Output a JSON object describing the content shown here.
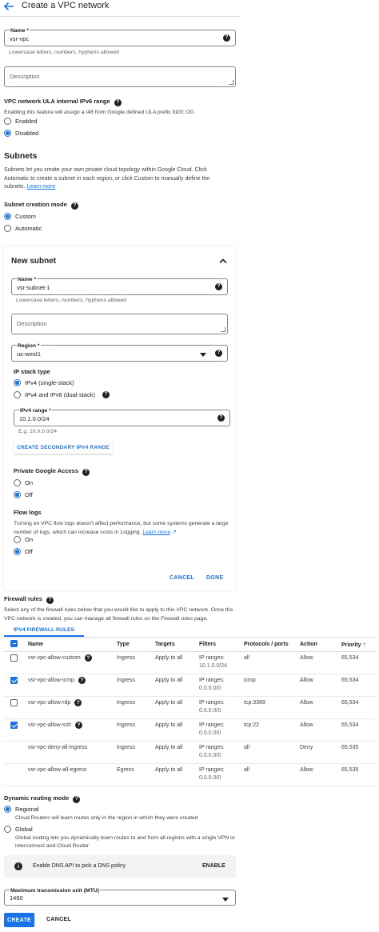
{
  "page_title": "Create a VPC network",
  "name_field": {
    "label": "Name *",
    "value": "vsr-vpc",
    "hint": "Lowercase letters, numbers, hyphens allowed"
  },
  "description_field": {
    "placeholder": "Description"
  },
  "ula": {
    "heading": "VPC network ULA internal IPv6 range",
    "text": "Enabling this feature will assign a /48 from Google defined ULA prefix fd20::/20.",
    "options": [
      "Enabled",
      "Disabled"
    ],
    "selected": "Disabled"
  },
  "subnets": {
    "heading": "Subnets",
    "text": "Subnets let you create your own private cloud topology within Google Cloud. Click Automatic to create a subnet in each region, or click Custom to manually define the subnets.",
    "learn_more": "Learn more",
    "mode_heading": "Subnet creation mode",
    "mode_options": [
      "Custom",
      "Automatic"
    ],
    "mode_selected": "Custom"
  },
  "new_subnet": {
    "title": "New subnet",
    "name_label": "Name *",
    "name_value": "vsr-subnet-1",
    "name_hint": "Lowercase letters, numbers, hyphens allowed",
    "description_placeholder": "Description",
    "region_label": "Region *",
    "region_value": "us-west1",
    "ip_stack_heading": "IP stack type",
    "ip_stack_options": [
      "IPv4 (single-stack)",
      "IPv4 and IPv6 (dual-stack)"
    ],
    "ip_stack_selected": "IPv4 (single-stack)",
    "ipv4_label": "IPv4 range *",
    "ipv4_value": "10.1.0.0/24",
    "ipv4_hint": "E.g. 10.0.0.0/24",
    "secondary_button": "CREATE SECONDARY IPV4 RANGE",
    "pga_heading": "Private Google Access",
    "pga_options": [
      "On",
      "Off"
    ],
    "pga_selected": "Off",
    "flow_heading": "Flow logs",
    "flow_text": "Turning on VPC flow logs doesn't affect performance, but some systems generate a large number of logs, which can increase costs in Logging.",
    "flow_learn_more": "Learn more",
    "flow_options": [
      "On",
      "Off"
    ],
    "flow_selected": "Off",
    "cancel": "CANCEL",
    "done": "DONE"
  },
  "firewall": {
    "heading": "Firewall rules",
    "text": "Select any of the firewall rules below that you would like to apply to this VPC network. Once the VPC network is created, you can manage all firewall rules on the Firewall rules page.",
    "tab": "IPV4 FIREWALL RULES",
    "columns": [
      "Name",
      "Type",
      "Targets",
      "Filters",
      "Protocols / ports",
      "Action",
      "Priority"
    ],
    "rows": [
      {
        "checkbox": "unchecked",
        "name": "vsr-vpc-allow-custom",
        "help": true,
        "type": "Ingress",
        "targets": "Apply to all",
        "filter1": "IP ranges:",
        "filter2": "10.1.0.0/24",
        "protocols": "all",
        "action": "Allow",
        "priority": "65,534"
      },
      {
        "checkbox": "checked",
        "name": "vsr-vpc-allow-icmp",
        "help": true,
        "type": "Ingress",
        "targets": "Apply to all",
        "filter1": "IP ranges:",
        "filter2": "0.0.0.0/0",
        "protocols": "icmp",
        "action": "Allow",
        "priority": "65,534"
      },
      {
        "checkbox": "unchecked",
        "name": "vsr-vpc-allow-rdp",
        "help": true,
        "type": "Ingress",
        "targets": "Apply to all",
        "filter1": "IP ranges:",
        "filter2": "0.0.0.0/0",
        "protocols": "tcp:3389",
        "action": "Allow",
        "priority": "65,534"
      },
      {
        "checkbox": "checked",
        "name": "vsr-vpc-allow-ssh",
        "help": true,
        "type": "Ingress",
        "targets": "Apply to all",
        "filter1": "IP ranges:",
        "filter2": "0.0.0.0/0",
        "protocols": "tcp:22",
        "action": "Allow",
        "priority": "65,534"
      },
      {
        "checkbox": "none",
        "name": "vsr-vpc-deny-all-ingress",
        "help": false,
        "type": "Ingress",
        "targets": "Apply to all",
        "filter1": "IP ranges:",
        "filter2": "0.0.0.0/0",
        "protocols": "all",
        "action": "Deny",
        "priority": "65,535"
      },
      {
        "checkbox": "none",
        "name": "vsr-vpc-allow-all-egress",
        "help": false,
        "type": "Egress",
        "targets": "Apply to all",
        "filter1": "IP ranges:",
        "filter2": "0.0.0.0/0",
        "protocols": "all",
        "action": "Allow",
        "priority": "65,535"
      }
    ]
  },
  "routing": {
    "heading": "Dynamic routing mode",
    "regional_label": "Regional",
    "regional_desc": "Cloud Routers will learn routes only in the region in which they were created",
    "global_label": "Global",
    "global_desc": "Global routing lets you dynamically learn routes to and from all regions with a single VPN or interconnect and Cloud Router",
    "selected": "Regional"
  },
  "dns_banner": {
    "text": "Enable DNS API to pick a DNS policy",
    "button": "ENABLE"
  },
  "mtu": {
    "label": "Maximum transmission unit (MTU)",
    "value": "1460"
  },
  "footer": {
    "create": "CREATE",
    "cancel": "CANCEL"
  },
  "colors": {
    "accent": "#1a73e8",
    "text": "#202124",
    "muted": "#5f6368"
  },
  "icons": [
    "back-arrow-icon",
    "help-icon",
    "chevron-up-icon",
    "dropdown-arrow-icon",
    "info-icon",
    "external-link-icon",
    "sort-arrow-up-icon"
  ]
}
